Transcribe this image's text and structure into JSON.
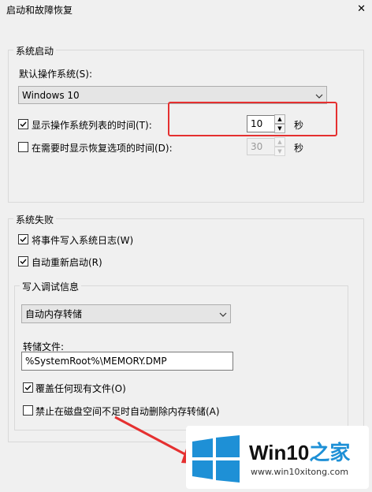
{
  "window": {
    "title": "启动和故障恢复"
  },
  "startup": {
    "group_label": "系统启动",
    "default_os_label": "默认操作系统(S):",
    "default_os_value": "Windows 10",
    "show_list_label": "显示操作系统列表的时间(T):",
    "show_list_checked": true,
    "show_list_value": "10",
    "show_list_unit": "秒",
    "recovery_label": "在需要时显示恢复选项的时间(D):",
    "recovery_checked": false,
    "recovery_value": "30",
    "recovery_unit": "秒"
  },
  "failure": {
    "group_label": "系统失败",
    "write_event_label": "将事件写入系统日志(W)",
    "write_event_checked": true,
    "auto_restart_label": "自动重新启动(R)",
    "auto_restart_checked": true
  },
  "debug": {
    "group_label": "写入调试信息",
    "dump_type_value": "自动内存转储",
    "dump_file_label": "转储文件:",
    "dump_file_value": "%SystemRoot%\\MEMORY.DMP",
    "overwrite_label": "覆盖任何现有文件(O)",
    "overwrite_checked": true,
    "disable_auto_delete_label": "禁止在磁盘空间不足时自动删除内存转储(A)",
    "disable_auto_delete_checked": false
  },
  "watermark": {
    "brand": "Win10",
    "brand_suffix": "之家",
    "url": "www.win10xitong.com"
  },
  "colors": {
    "highlight": "#e53030",
    "win_blue": "#1e90d6"
  },
  "icons": {
    "close": "close-icon",
    "dropdown": "chevron-down-icon",
    "check": "check-icon"
  }
}
